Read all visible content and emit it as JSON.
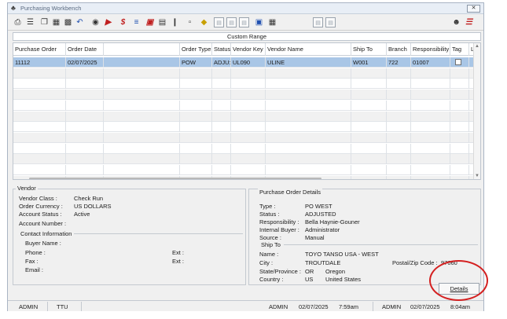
{
  "window": {
    "title": "Purchasing Workbench",
    "close_label": "✕"
  },
  "toolbar": {
    "icons": [
      "printer-icon",
      "list-icon",
      "copy-icon",
      "export-icon",
      "undo-icon",
      "binoculars-icon",
      "exit-icon",
      "dollar-icon",
      "lines-icon",
      "form-icon",
      "report-icon",
      "clip-icon",
      "doc-icon",
      "tag-icon",
      "page-icon",
      "page-icon",
      "page-icon",
      "window-icon",
      "calc-icon",
      "page-icon",
      "page-icon",
      "user-icon",
      "checklist-icon"
    ]
  },
  "range": {
    "label": "Custom Range"
  },
  "grid": {
    "columns": [
      "Purchase Order",
      "Order Date",
      "",
      "Order Type",
      "Status",
      "Vendor Key",
      "Vendor Name",
      "Ship To",
      "Branch",
      "Responsibility",
      "Tag",
      "L"
    ],
    "rows": [
      {
        "po": "11112",
        "date": "02/07/2025",
        "blank": "",
        "type": "POW",
        "status": "ADJU:",
        "vkey": "UL090",
        "vname": "ULINE",
        "ship": "W001",
        "branch": "722",
        "resp": "01007",
        "tag": false
      }
    ]
  },
  "vendor": {
    "title": "Vendor",
    "class_label": "Vendor Class :",
    "class_value": "Check Run",
    "currency_label": "Order Currency :",
    "currency_value": "US DOLLARS",
    "status_label": "Account Status :",
    "status_value": "Active",
    "acct_label": "Account Number :",
    "contact_title": "Contact Information",
    "buyer_label": "Buyer Name :",
    "phone_label": "Phone :",
    "fax_label": "Fax :",
    "email_label": "Email :",
    "ext1_label": "Ext :",
    "ext2_label": "Ext :"
  },
  "po_details": {
    "title": "Purchase Order Details",
    "type_label": "Type :",
    "type_value": "PO WEST",
    "status_label": "Status :",
    "status_value": "ADJUSTED",
    "resp_label": "Responsibility :",
    "resp_value": "Bella Haynie-Gouner",
    "buyer_label": "Internal Buyer :",
    "buyer_value": "Administrator",
    "source_label": "Source :",
    "source_value": "Manual",
    "shipto_title": "Ship To",
    "name_label": "Name :",
    "name_value": "TOYO TANSO USA - WEST",
    "city_label": "City :",
    "city_value": "TROUTDALE",
    "postal_label": "Postal/Zip Code :",
    "postal_value": "97060",
    "state_label": "State/Province :",
    "state_code": "OR",
    "state_name": "Oregon",
    "country_label": "Country :",
    "country_code": "US",
    "country_name": "United States"
  },
  "buttons": {
    "details": "Details"
  },
  "status": {
    "user1": "ADMIN",
    "env": "TTU",
    "user2": "ADMIN",
    "date1": "02/07/2025",
    "time1": "7:59am",
    "user3": "ADMIN",
    "date2": "02/07/2025",
    "time2": "8:04am"
  },
  "colors": {
    "selected_row": "#a9c6e6",
    "annotation": "#d42020"
  }
}
